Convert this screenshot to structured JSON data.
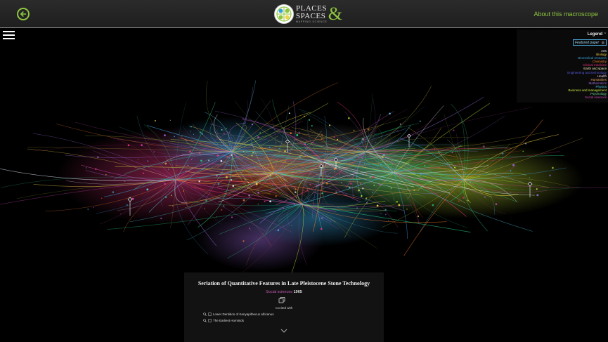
{
  "header": {
    "logo_line1": "PLACES",
    "logo_line2": "SPACES",
    "logo_amp": "&",
    "logo_subtitle": "MAPPING SCIENCE",
    "about_label": "About this macroscope",
    "accent_color": "#8ec63f"
  },
  "legend": {
    "title": "Legend",
    "featured_label": "Featured paper",
    "items": [
      {
        "label": "Arts",
        "color": "#e8e8e8"
      },
      {
        "label": "Biology",
        "color": "#f2d34a"
      },
      {
        "label": "Biomedical research",
        "color": "#3aa0d8"
      },
      {
        "label": "Chemistry",
        "color": "#f27b2a"
      },
      {
        "label": "Clinical medicine",
        "color": "#e0357a"
      },
      {
        "label": "Earth and space",
        "color": "#f5f5c0"
      },
      {
        "label": "Engineering and technology",
        "color": "#5b5be0"
      },
      {
        "label": "Health",
        "color": "#f0c8e0"
      },
      {
        "label": "Humanities",
        "color": "#f0a868"
      },
      {
        "label": "Mathematics",
        "color": "#9a68d8"
      },
      {
        "label": "Physics",
        "color": "#4fc6e0"
      },
      {
        "label": "Business and management",
        "color": "#c8e83a"
      },
      {
        "label": "Psychology",
        "color": "#6ad89a"
      },
      {
        "label": "Social sciences",
        "color": "#d048b8"
      }
    ]
  },
  "featured_paper": {
    "title": "Seriation of Quantitative Features in Late Pleistocene Stone Technology",
    "field": "Social sciences",
    "year": "1965",
    "cocited_label": "Cocited with",
    "cocited": [
      "Lower Dentition of Kenyapithecus africanus",
      "The Earliest Hominids"
    ]
  }
}
